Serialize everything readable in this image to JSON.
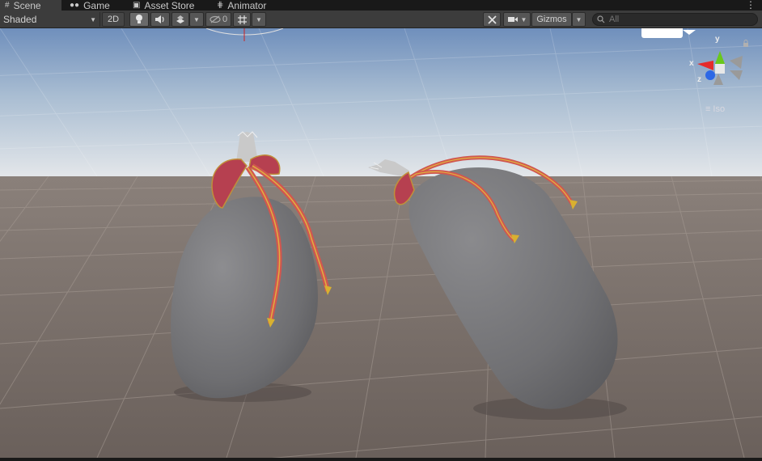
{
  "tabs": [
    {
      "label": "Scene",
      "icon": "grid-icon"
    },
    {
      "label": "Game",
      "icon": "gamepad-icon"
    },
    {
      "label": "Asset Store",
      "icon": "store-icon"
    },
    {
      "label": "Animator",
      "icon": "animator-icon"
    }
  ],
  "toolbar": {
    "draw_mode": "Shaded",
    "two_d_label": "2D",
    "hidden_count": "0",
    "gizmos_label": "Gizmos",
    "search_placeholder": "All"
  },
  "orientation_gizmo": {
    "x_label": "x",
    "y_label": "y",
    "z_label": "z",
    "projection_label": "Iso"
  },
  "colors": {
    "tab_bar": "#191919",
    "toolbar": "#3c3c3c",
    "sky_top": "#6f8fbc",
    "sky_horizon": "#e4e7ea",
    "ground": "#6e645e",
    "bag": "#7d7d80",
    "ribbon": "#c54a5a",
    "ribbon_trim": "#d8a830",
    "axis_x": "#e52b2b",
    "axis_y": "#69c81c",
    "axis_z": "#2d68e6"
  },
  "icons": [
    "lightbulb-icon",
    "audio-icon",
    "effects-icon",
    "hidden-visibility-icon",
    "grid-snap-icon",
    "tools-icon",
    "camera-icon",
    "search-icon",
    "lock-icon"
  ]
}
